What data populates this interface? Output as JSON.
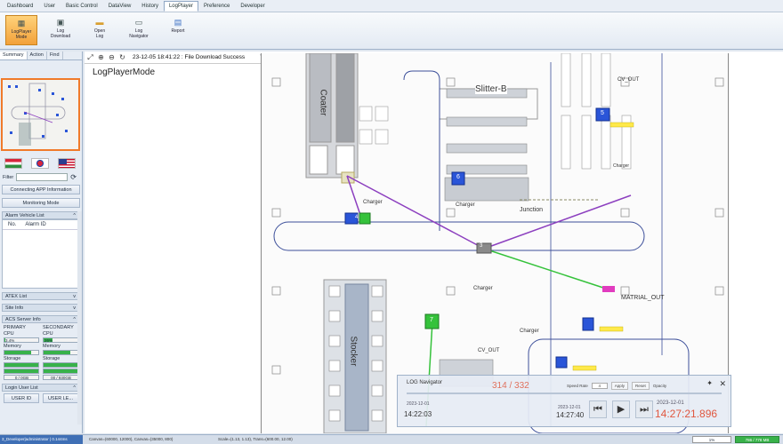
{
  "menu": [
    "Dashboard",
    "User",
    "Basic Control",
    "DataView",
    "History",
    "LogPlayer",
    "Preference",
    "Developer"
  ],
  "ribbon": [
    {
      "line1": "LogPlayer",
      "line2": "Mode"
    },
    {
      "line1": "Log",
      "line2": "Download"
    },
    {
      "line1": "Open",
      "line2": "Log"
    },
    {
      "line1": "Log",
      "line2": "Navigator"
    },
    {
      "line1": "Report",
      "line2": ""
    }
  ],
  "left": {
    "tabs": [
      "Summary",
      "Action",
      "Find"
    ],
    "filter_label": "Filter",
    "btn_connect": "Connecting APP Information",
    "btn_monitor": "Monitoring Mode",
    "alarm_header": "Alarm Vehicle List",
    "alarm_col_no": "No.",
    "alarm_col_id": "Alarm ID",
    "atex": "ATEX List",
    "site": "Site Info",
    "acs": "ACS Server Info",
    "primary": "PRIMARY",
    "secondary": "SECONDARY",
    "cpu": "CPU",
    "memory": "Memory",
    "storage": "Storage",
    "cpu1": "3.4%",
    "cpu2": "26%",
    "cpu1_level": 0.034,
    "cpu2_level": 0.26,
    "mem1_level": 0.8,
    "mem2_level": 0.8,
    "st1": "0 / 0GB",
    "st2": "00 / 930GB",
    "login_header": "Login User List",
    "user_id": "USER ID",
    "user_le": "USER LE..."
  },
  "canvas": {
    "status_text": "23-12-05 18:41:22 : File Download Success",
    "mode_label": "LogPlayerMode",
    "labels": {
      "coater": "Coater",
      "slitter": "Slitter-B",
      "stocker": "Stocker",
      "junction": "Junction",
      "charger": "Charger",
      "cv_out": "CV_OUT",
      "matrial_out": "MATRIAL_OUT"
    },
    "vehicles": [
      "5",
      "6",
      "4",
      "7",
      "3"
    ]
  },
  "lognav": {
    "title": "LOG Navigator",
    "count": "314 / 332",
    "speed_rate": "Speed Rate",
    "speed_val": "4",
    "apply": "Apply",
    "reset": "Reset",
    "opacity": "Opacity",
    "start_date": "2023-12-01",
    "start_time": "14:22:03",
    "mid_date": "2023-12-01",
    "mid_time": "14:27:40",
    "cur_date": "2023-12-01",
    "cur_time": "14:27:21.896"
  },
  "status": {
    "user": "3_Developer|administrator | 0.144ms",
    "canvas": "Canvas=(60000, 12000), Canvas=(35000, 800)",
    "scale": "Scale=(1.13, 1.13), Trans=(600.00, 12.00)",
    "pct": "1%",
    "mem": "786 / 778 MB"
  },
  "colors": {
    "accent": "#f2a13a",
    "vehicle": "#2a55d8",
    "green": "#35c23b",
    "purple": "#8c3fbf",
    "orange": "#f07a2a"
  }
}
